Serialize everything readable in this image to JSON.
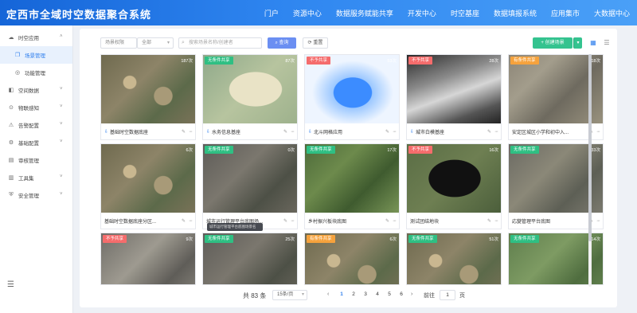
{
  "app": {
    "title": "定西市全域时空数据聚合系统"
  },
  "nav": [
    "门户",
    "资源中心",
    "数据服务赋能共享",
    "开发中心",
    "时空基座",
    "数据填报系统",
    "应用集市",
    "大数据中心"
  ],
  "sidebar": {
    "items": [
      {
        "label": "时空应用",
        "icon": "cloud-icon",
        "expanded": true
      },
      {
        "label": "场景管理",
        "icon": "scene-icon",
        "sub": true,
        "active": true
      },
      {
        "label": "功能管理",
        "icon": "function-icon",
        "sub": true
      },
      {
        "label": "空间数据",
        "icon": "layers-icon",
        "chevron": true
      },
      {
        "label": "物联感知",
        "icon": "sensor-icon",
        "chevron": true
      },
      {
        "label": "告警配置",
        "icon": "alarm-icon",
        "chevron": true
      },
      {
        "label": "基础配置",
        "icon": "config-icon",
        "chevron": true
      },
      {
        "label": "审核管理",
        "icon": "audit-icon"
      },
      {
        "label": "工具集",
        "icon": "toolbox-icon",
        "chevron": true
      },
      {
        "label": "安全管理",
        "icon": "shield-icon",
        "chevron": true
      }
    ]
  },
  "toolbar": {
    "filter_label": "场景权限",
    "filter_value": "全部",
    "search_placeholder": "搜索场景名称/创建者",
    "search_label": "查询",
    "reset_label": "重置",
    "create_label": "+ 创建场景"
  },
  "cards": [
    {
      "name": "基础时空数据底座",
      "tag": "",
      "tag_color": "",
      "count": "187次",
      "pinned": true,
      "theme": "city"
    },
    {
      "name": "水务信息基座",
      "tag": "无条件共享",
      "tag_color": "g",
      "count": "87次",
      "pinned": true,
      "theme": "map"
    },
    {
      "name": "北斗网格应用",
      "tag": "不予共享",
      "tag_color": "r",
      "count": "53次",
      "pinned": true,
      "theme": "grid3d"
    },
    {
      "name": "城市白模基座",
      "tag": "不予共享",
      "tag_color": "r",
      "count": "28次",
      "pinned": true,
      "theme": "white"
    },
    {
      "name": "安定区城区小学和初中入...",
      "tag": "有条件共享",
      "tag_color": "o",
      "count": "18次",
      "pinned": false,
      "theme": "urban"
    },
    {
      "name": "基础时空数据底座分区...",
      "tag": "",
      "tag_color": "",
      "count": "6次",
      "pinned": false,
      "theme": "city"
    },
    {
      "name": "城市运行管理平台底图场...",
      "tag": "无条件共享",
      "tag_color": "g",
      "count": "0次",
      "pinned": false,
      "theme": "dense"
    },
    {
      "name": "乡村振兴板块底图",
      "tag": "无条件共享",
      "tag_color": "g",
      "count": "17次",
      "pinned": false,
      "theme": "farm"
    },
    {
      "name": "测试团结地块",
      "tag": "不予共享",
      "tag_color": "r",
      "count": "16次",
      "pinned": false,
      "theme": "black"
    },
    {
      "name": "応變管理平台底图",
      "tag": "无条件共享",
      "tag_color": "g",
      "count": "33次",
      "pinned": false,
      "theme": "aerial"
    },
    {
      "name": "",
      "tag": "不予共享",
      "tag_color": "r",
      "count": "9次",
      "pinned": false,
      "theme": "buildings"
    },
    {
      "name": "",
      "tag": "无条件共享",
      "tag_color": "g",
      "count": "25次",
      "pinned": false,
      "theme": "dense"
    },
    {
      "name": "",
      "tag": "有条件共享",
      "tag_color": "o",
      "count": "6次",
      "pinned": false,
      "theme": "city"
    },
    {
      "name": "",
      "tag": "无条件共享",
      "tag_color": "g",
      "count": "51次",
      "pinned": false,
      "theme": "city"
    },
    {
      "name": "",
      "tag": "无条件共享",
      "tag_color": "g",
      "count": "14次",
      "pinned": false,
      "theme": "green"
    }
  ],
  "tooltip": "城市运行管理平台底图场景名",
  "pager": {
    "total": "共 83 条",
    "size": "15条/页",
    "pages": [
      "1",
      "2",
      "3",
      "4",
      "5",
      "6"
    ],
    "active": "1",
    "goto_label": "前往",
    "goto_value": "1",
    "page_label": "页"
  },
  "colors": {
    "header": "#2f86f0",
    "accent": "#2f7fed",
    "green": "#2fbf83",
    "red": "#f56c6c",
    "orange": "#f6a23c"
  }
}
